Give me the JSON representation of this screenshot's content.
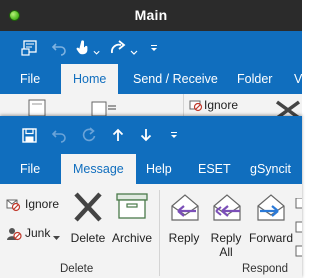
{
  "main_window": {
    "title": "Main",
    "tabs": [
      {
        "label": "File"
      },
      {
        "label": "Home"
      },
      {
        "label": "Send / Receive"
      },
      {
        "label": "Folder"
      },
      {
        "label": "V"
      }
    ],
    "partial_ignore": "Ignore"
  },
  "message_window": {
    "tabs": [
      {
        "label": "File"
      },
      {
        "label": "Message"
      },
      {
        "label": "Help"
      },
      {
        "label": "ESET"
      },
      {
        "label": "gSyncit"
      }
    ],
    "delete_group": {
      "ignore_label": "Ignore",
      "junk_label": "Junk",
      "delete_label": "Delete",
      "archive_label": "Archive",
      "group_label": "Delete"
    },
    "respond_group": {
      "reply_label": "Reply",
      "reply_all_line1": "Reply",
      "reply_all_line2": "All",
      "forward_label": "Forward",
      "group_label": "Respond"
    }
  },
  "colors": {
    "accent": "#106ebe",
    "titlebar": "#2b2b2b",
    "ribbon": "#f3f3f3",
    "reply_purple": "#7b4fb8",
    "forward_blue": "#2b79d6",
    "delete_gray": "#444444"
  }
}
